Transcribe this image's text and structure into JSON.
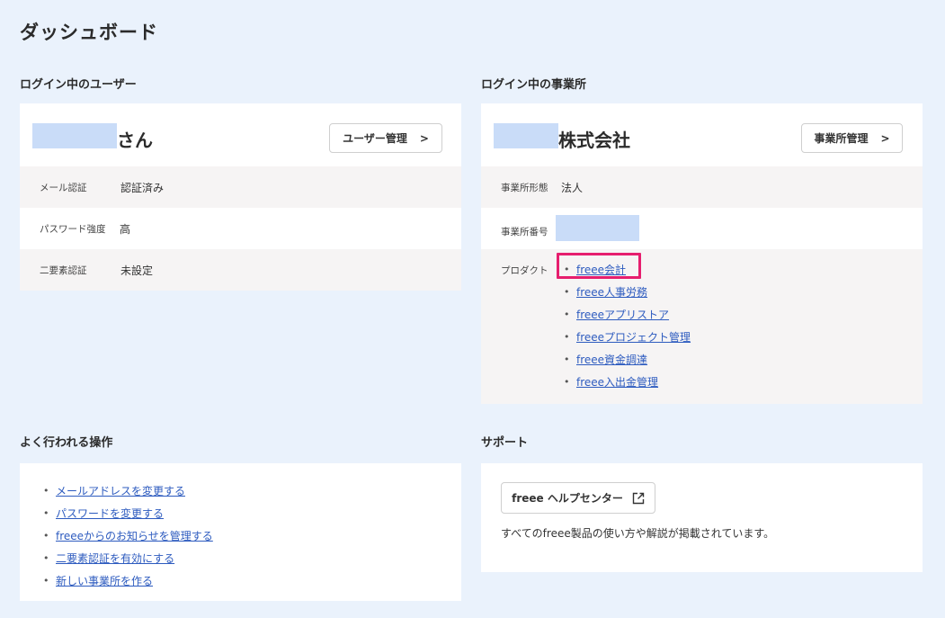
{
  "page": {
    "title": "ダッシュボード"
  },
  "user_section": {
    "title": "ログイン中のユーザー",
    "name_suffix": "さん",
    "manage_button": "ユーザー管理",
    "rows": [
      {
        "label": "メール認証",
        "value": "認証済み"
      },
      {
        "label": "パスワード強度",
        "value": "高"
      },
      {
        "label": "二要素認証",
        "value": "未設定"
      }
    ]
  },
  "office_section": {
    "title": "ログイン中の事業所",
    "name_suffix": "株式会社",
    "manage_button": "事業所管理",
    "type_label": "事業所形態",
    "type_value": "法人",
    "number_label": "事業所番号",
    "products_label": "プロダクト",
    "products": [
      "freee会計",
      "freee人事労務",
      "freeeアプリストア",
      "freeeプロジェクト管理",
      "freee資金調達",
      "freee入出金管理"
    ]
  },
  "frequent_section": {
    "title": "よく行われる操作",
    "links": [
      "メールアドレスを変更する",
      "パスワードを変更する",
      "freeeからのお知らせを管理する",
      "二要素認証を有効にする",
      "新しい事業所を作る"
    ]
  },
  "support_section": {
    "title": "サポート",
    "help_button": "freee ヘルプセンター",
    "description": "すべてのfreee製品の使い方や解説が掲載されています。"
  },
  "colors": {
    "background": "#eaf2fc",
    "link": "#2d5bbf",
    "highlight": "#e61e6e",
    "redacted": "#c9dcf8"
  },
  "icons": {
    "chevron": "chevron-right-icon",
    "external": "external-link-icon"
  }
}
